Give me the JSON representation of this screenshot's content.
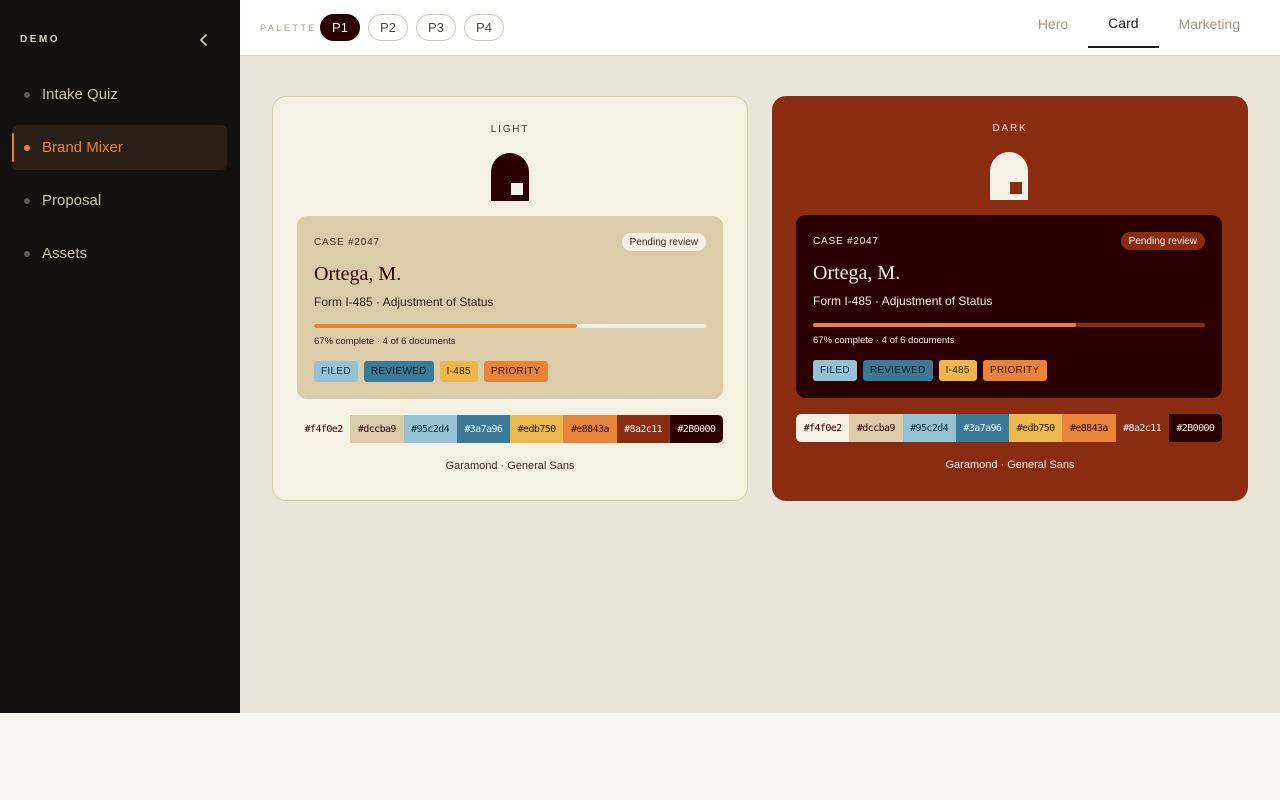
{
  "sidebar": {
    "brand": "DEMO",
    "collapse_icon": "chevron-left-icon",
    "items": [
      {
        "label": "Intake Quiz"
      },
      {
        "label": "Brand Mixer"
      },
      {
        "label": "Proposal"
      },
      {
        "label": "Assets"
      }
    ],
    "active_index": 1
  },
  "topbar": {
    "palette_label": "PALETTE",
    "palettes": [
      "P1",
      "P2",
      "P3",
      "P4"
    ],
    "active_palette": "P1",
    "tabs": [
      "Hero",
      "Card",
      "Marketing"
    ],
    "active_tab": "Card"
  },
  "panels": {
    "light": {
      "title": "LIGHT",
      "logo_icon": "arch-door-logo",
      "case_number": "CASE #2047",
      "status": "Pending review",
      "name": "Ortega, M.",
      "form": "Form I-485 · Adjustment of Status",
      "progress": 0.67,
      "progress_text": "67% complete · 4 of 6 documents",
      "tags": [
        "FILED",
        "REVIEWED",
        "I-485",
        "PRIORITY"
      ],
      "swatches": [
        "#f4f0e2",
        "#dccba9",
        "#95c2d4",
        "#3a7a96",
        "#edb750",
        "#e8843a",
        "#8a2c11",
        "#2B0000"
      ],
      "fonts": "Garamond · General Sans"
    },
    "dark": {
      "title": "DARK",
      "logo_icon": "arch-door-logo",
      "case_number": "CASE #2047",
      "status": "Pending review",
      "name": "Ortega, M.",
      "form": "Form I-485 · Adjustment of Status",
      "progress": 0.67,
      "progress_text": "67% complete · 4 of 6 documents",
      "tags": [
        "FILED",
        "REVIEWED",
        "I-485",
        "PRIORITY"
      ],
      "swatches": [
        "#f4f0e2",
        "#dccba9",
        "#95c2d4",
        "#3a7a96",
        "#edb750",
        "#e8843a",
        "#8a2c11",
        "#2B0000"
      ],
      "fonts": "Garamond · General Sans"
    }
  },
  "colors": {
    "accent": "#e8843a",
    "cream": "#f4f0e2",
    "sand": "#dccba9",
    "sky": "#95c2d4",
    "teal": "#3a7a96",
    "mustard": "#edb750",
    "orange": "#e8843a",
    "rust": "#8a2c11",
    "oxblood": "#2B0000"
  }
}
